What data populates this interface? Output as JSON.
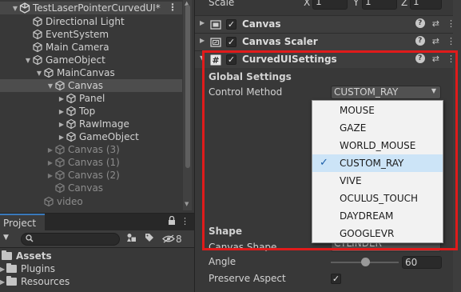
{
  "hierarchy": {
    "scene_name": "TestLaserPointerCurvedUI*",
    "items": [
      {
        "label": "Directional Light"
      },
      {
        "label": "EventSystem"
      },
      {
        "label": "Main Camera"
      },
      {
        "label": "GameObject"
      },
      {
        "label": "MainCanvas"
      },
      {
        "label": "Canvas"
      },
      {
        "label": "Panel"
      },
      {
        "label": "Top"
      },
      {
        "label": "RawImage"
      },
      {
        "label": "GameObject"
      },
      {
        "label": "Canvas (3)"
      },
      {
        "label": "Canvas (1)"
      },
      {
        "label": "Canvas (2)"
      },
      {
        "label": "Canvas"
      },
      {
        "label": "video"
      }
    ]
  },
  "project": {
    "tab_label": "Project",
    "hidden_count": "8",
    "items": [
      {
        "label": "Assets"
      },
      {
        "label": "Plugins"
      },
      {
        "label": "Resources"
      }
    ]
  },
  "inspector": {
    "scale_label": "Scale",
    "scale": {
      "x_label": "X",
      "x": "1",
      "y_label": "Y",
      "y": "1",
      "z_label": "Z",
      "z": "1"
    },
    "components": [
      {
        "title": "Canvas"
      },
      {
        "title": "Canvas Scaler"
      },
      {
        "title": "CurvedUISettings"
      }
    ],
    "global_settings_label": "Global Settings",
    "control_method_label": "Control Method",
    "control_method_value": "CUSTOM_RAY",
    "shape_label": "Shape",
    "canvas_shape_label": "Canvas Shape",
    "canvas_shape_value": "CYLINDER",
    "angle_label": "Angle",
    "angle_value": "60",
    "angle_fraction": 0.5,
    "preserve_aspect_label": "Preserve Aspect",
    "preserve_aspect_checked": true
  },
  "dropdown": {
    "options": [
      "MOUSE",
      "GAZE",
      "WORLD_MOUSE",
      "CUSTOM_RAY",
      "VIVE",
      "OCULUS_TOUCH",
      "DAYDREAM",
      "GOOGLEVR"
    ],
    "selected": "CUSTOM_RAY",
    "tick": "✓"
  },
  "colors": {
    "highlight": "#e01b1b",
    "selection": "#cce4f7",
    "accent": "#3a79bb"
  }
}
